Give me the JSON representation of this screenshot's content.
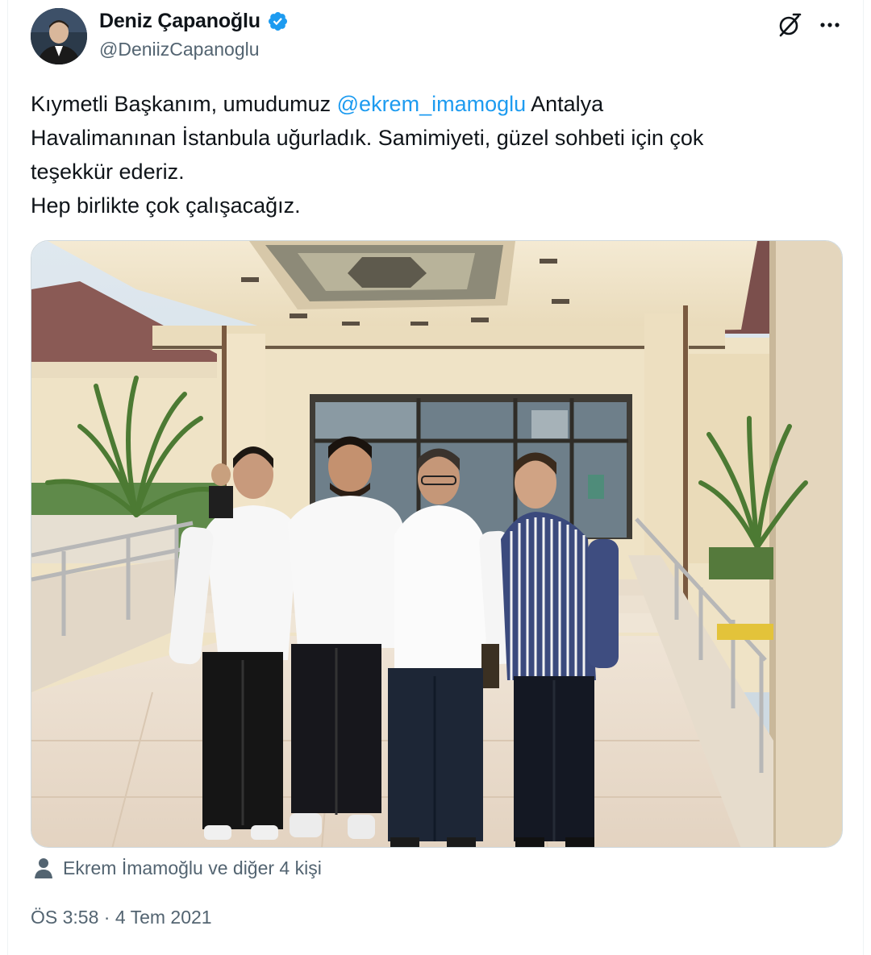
{
  "author": {
    "display_name": "Deniz Çapanoğlu",
    "handle": "@DeniizCapanoglu",
    "verified": true
  },
  "icons": {
    "verified": "verified-badge-icon",
    "grok": "grok-icon",
    "more": "more-options-icon",
    "person": "person-icon"
  },
  "tweet": {
    "line1_before": "Kıymetli Başkanım, umudumuz ",
    "mention": "@ekrem_imamoglu",
    "line1_after": " Antalya",
    "line2": "Havalimanınan İstanbula uğurladık. Samimiyeti, güzel sohbeti için çok",
    "line3": "teşekkür ederiz.",
    "line4": "Hep birlikte çok çalışacağız."
  },
  "media": {
    "type": "photo"
  },
  "tagged_people": "Ekrem İmamoğlu ve diğer 4 kişi",
  "timestamp": "ÖS 3:58 · 4 Tem 2021",
  "colors": {
    "text": "#0f1419",
    "secondary": "#536471",
    "link": "#1d9bf0",
    "verified": "#1d9bf0"
  }
}
